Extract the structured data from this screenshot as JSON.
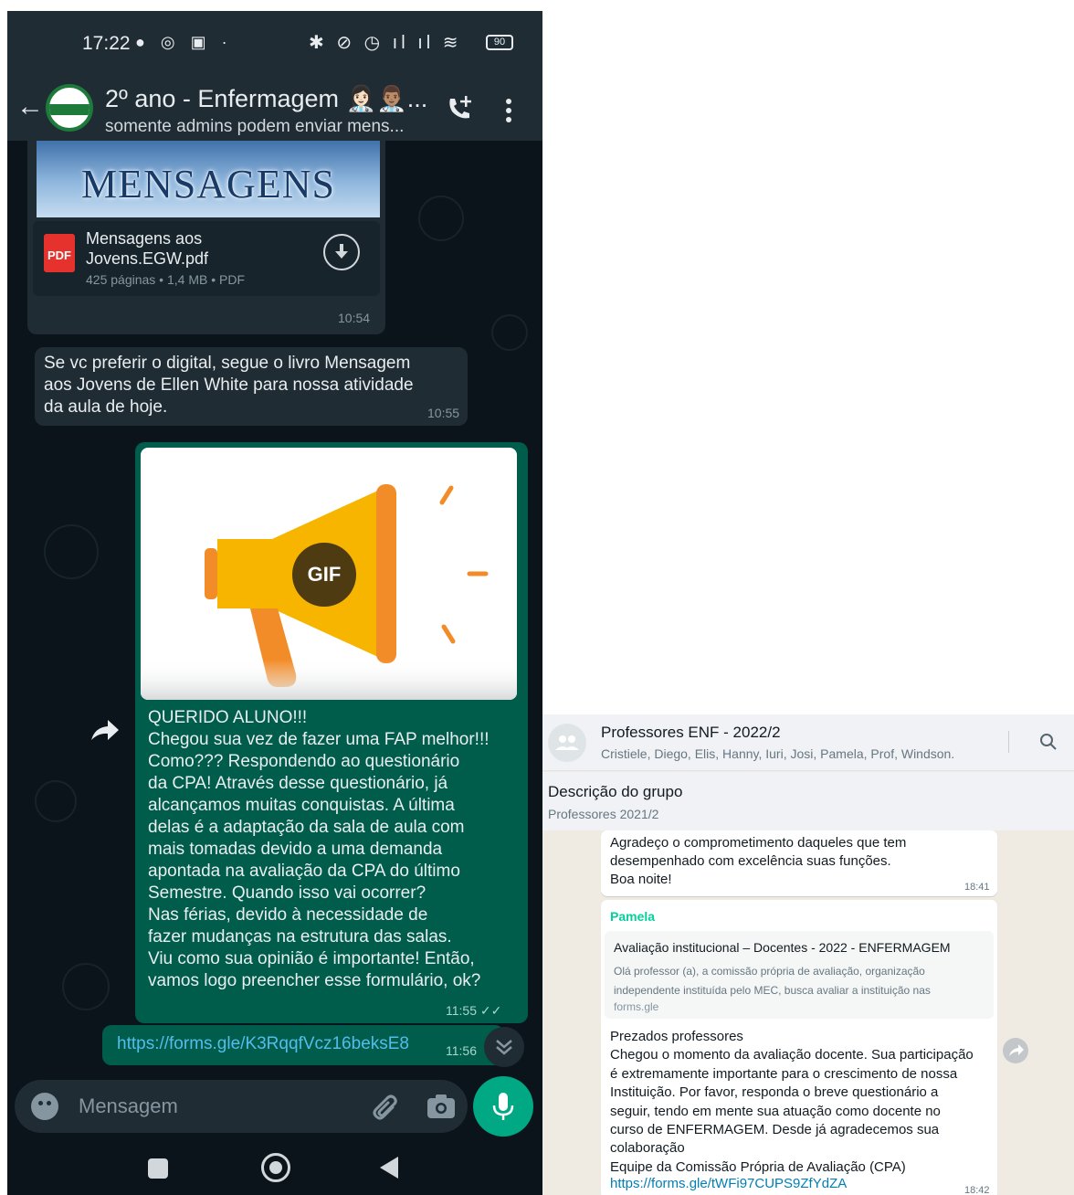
{
  "phone": {
    "status_bar": {
      "time": "17:22",
      "battery": "90"
    },
    "header": {
      "title": "2º ano - Enfermagem 👩🏻‍⚕️👨🏽‍⚕️...",
      "subtitle": "somente admins podem enviar mens..."
    },
    "messages": {
      "pdf": {
        "banner_text": "MENSAGENS",
        "file_name": "Mensagens aos Jovens.EGW.pdf",
        "file_meta": "425 páginas • 1,4 MB • PDF",
        "icon_label": "PDF",
        "time": "10:54"
      },
      "text_1": {
        "text": "Se vc preferir o digital, segue o livro Mensagem aos Jovens de Ellen White para nossa atividade da aula de hoje.",
        "time": "10:55"
      },
      "gif": {
        "badge": "GIF",
        "text": "QUERIDO ALUNO!!!\nChegou sua vez de fazer uma FAP melhor!!!\nComo??? Respondendo ao questionário\nda CPA! Através desse questionário, já\nalcançamos muitas conquistas. A última\ndelas é a adaptação da sala de aula com\nmais tomadas devido a uma demanda\napontada na avaliação da CPA do último\nSemestre. Quando isso vai ocorrer?\nNas férias, devido à necessidade de\nfazer mudanças na estrutura das salas.\nViu como sua opinião é importante! Então,\nvamos logo preencher esse formulário, ok?",
        "time": "11:55 ✓✓"
      },
      "link": {
        "url": "https://forms.gle/K3RqqfVcz16beksE8",
        "time": "11:56"
      }
    },
    "composer": {
      "placeholder": "Mensagem"
    }
  },
  "web": {
    "header": {
      "title": "Professores ENF - 2022/2",
      "members": "Cristiele, Diego, Elis, Hanny, Iuri, Josi, Pamela, Prof, Windson..."
    },
    "description": {
      "title": "Descrição do grupo",
      "text": "Professores 2021/2"
    },
    "message_1": {
      "text": "Agradeço o comprometimento daqueles que tem\ndesempenhado com excelência suas funções.\nBoa noite!",
      "time": "18:41"
    },
    "message_2": {
      "sender": "Pamela",
      "preview_title": "Avaliação institucional – Docentes - 2022 - ENFERMAGEM",
      "preview_desc": "Olá professor (a), a comissão própria de avaliação, organização independente instituída pelo MEC, busca avaliar a instituição nas",
      "preview_domain": "forms.gle",
      "body": "Prezados professores\nChegou o momento da avaliação docente. Sua participação\né extremamente importante para o crescimento de nossa\nInstituição. Por favor, responda o breve questionário a\nseguir, tendo em mente sua atuação como docente no\ncurso de ENFERMAGEM. Desde já agradecemos sua\ncolaboração\nEquipe da Comissão Própria de Avaliação (CPA)",
      "link": "https://forms.gle/tWFi97CUPS9ZfYdZA",
      "time": "18:42"
    }
  },
  "colors": {
    "whatsapp_dark_bg": "#0b141a",
    "whatsapp_dark_header": "#1f2c34",
    "outgoing_bubble": "#005c4b",
    "accent_green": "#00a884",
    "link_blue": "#53bdeb",
    "megaphone_yellow": "#f7b500"
  }
}
